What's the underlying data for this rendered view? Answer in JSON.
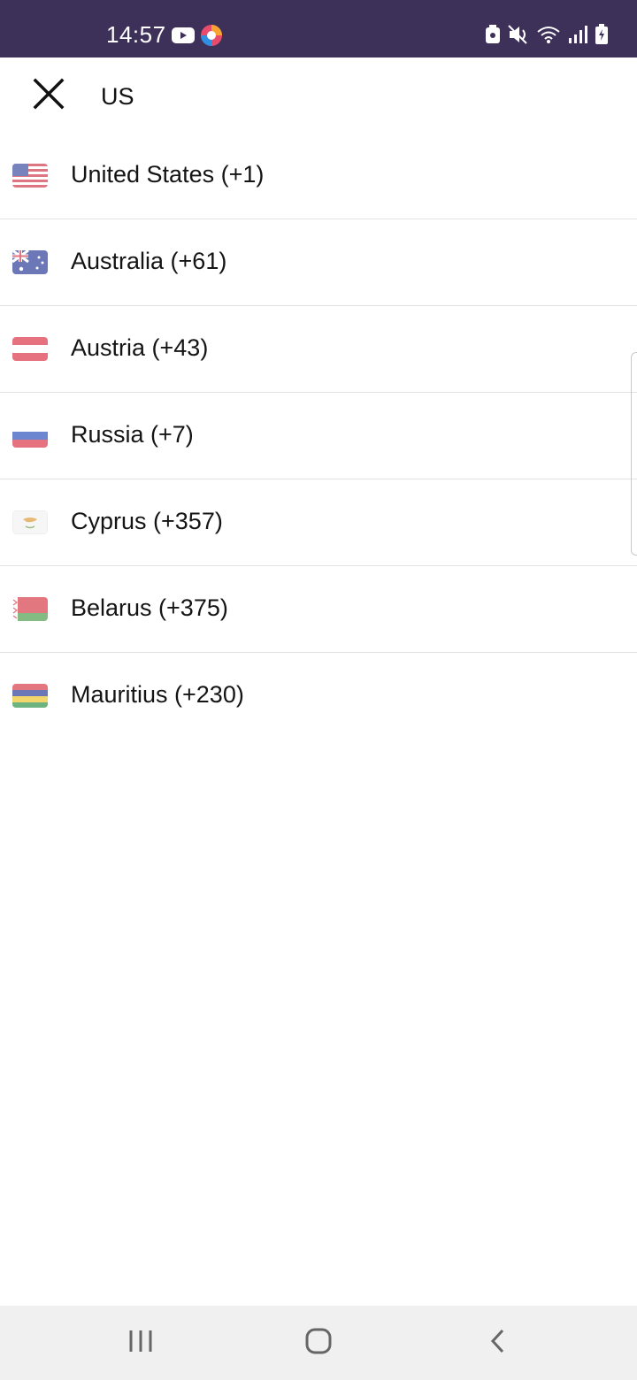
{
  "status_bar": {
    "time": "14:57",
    "left_icons": [
      "youtube-icon",
      "browser-app-icon"
    ],
    "right_icons": [
      "screenshot-icon",
      "mute-icon",
      "wifi-icon",
      "signal-icon",
      "battery-icon"
    ],
    "background": "#3d3159"
  },
  "search": {
    "query": "US",
    "close_icon": "close-icon"
  },
  "countries": [
    {
      "label": "United States (+1)",
      "flag": "us"
    },
    {
      "label": "Australia (+61)",
      "flag": "au"
    },
    {
      "label": "Austria (+43)",
      "flag": "at"
    },
    {
      "label": "Russia (+7)",
      "flag": "ru"
    },
    {
      "label": "Cyprus (+357)",
      "flag": "cy"
    },
    {
      "label": "Belarus (+375)",
      "flag": "by"
    },
    {
      "label": "Mauritius (+230)",
      "flag": "mu"
    }
  ],
  "nav_bar": {
    "buttons": [
      "recent-apps-icon",
      "home-icon",
      "back-icon"
    ]
  }
}
